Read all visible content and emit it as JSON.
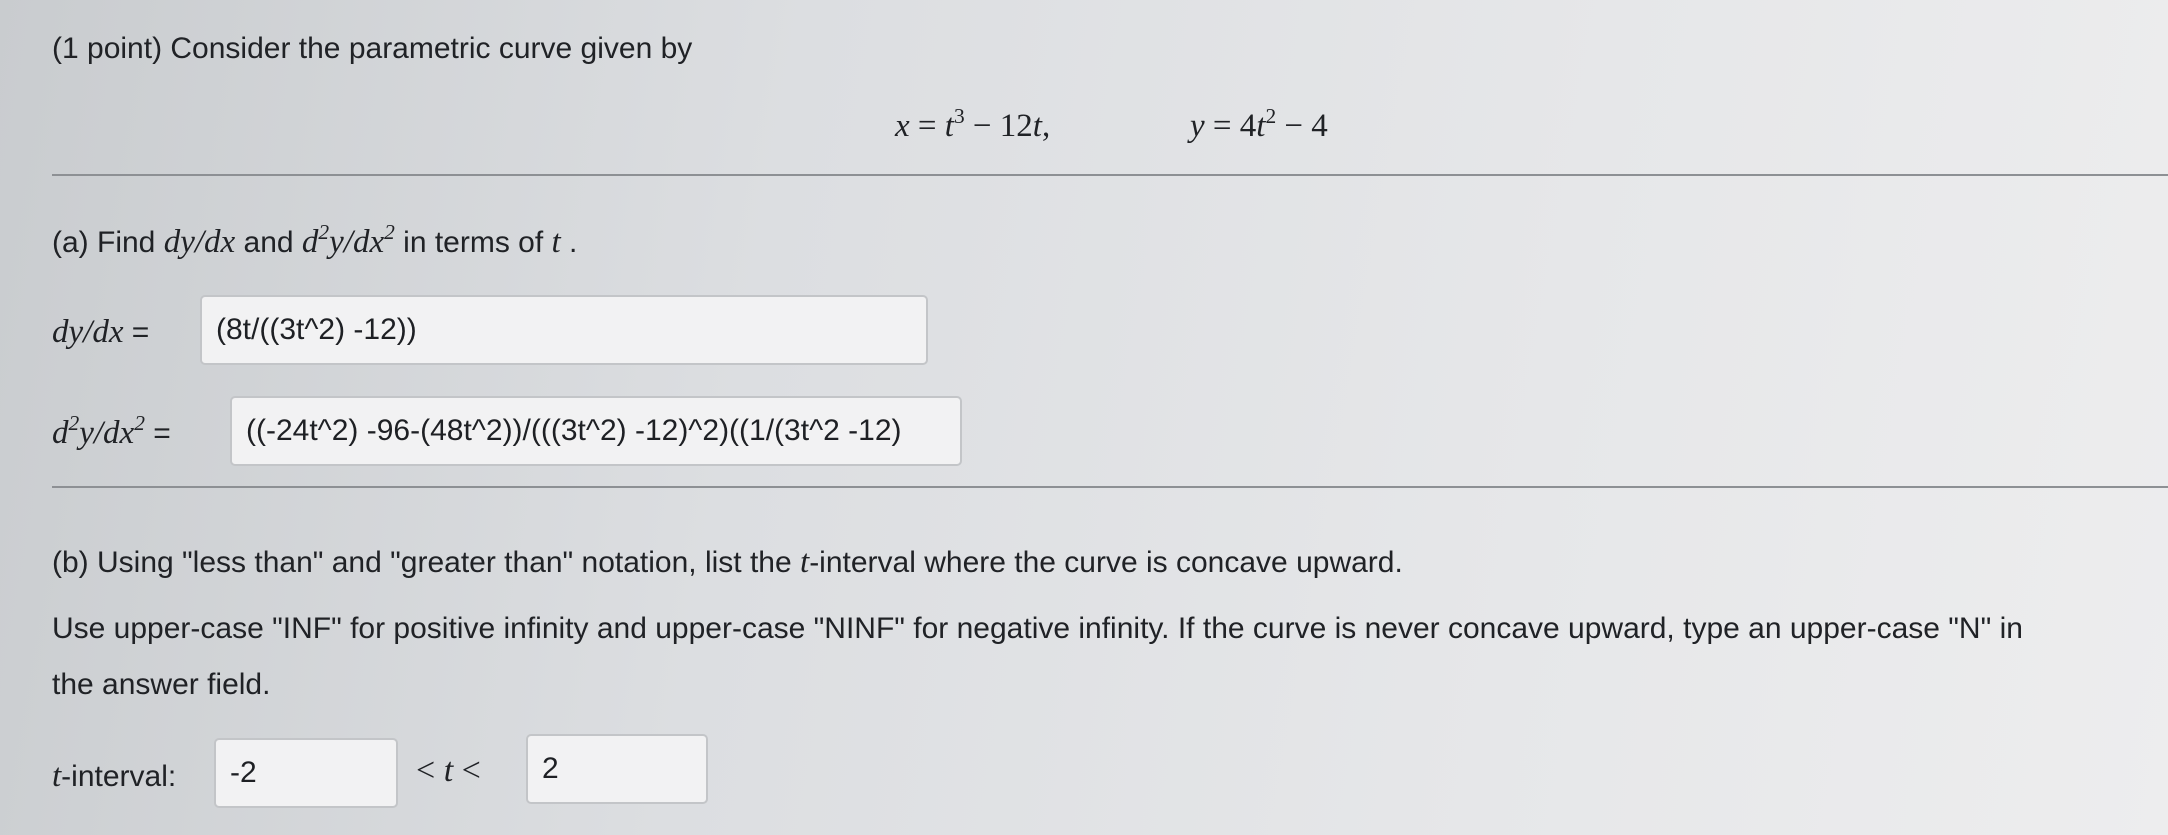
{
  "intro": {
    "text": "(1 point) Consider the parametric curve given by"
  },
  "equations": {
    "x_lhs": "x",
    "x_t": "t",
    "x_t_exp": "3",
    "x_rest": " − 12",
    "x_tail": ",",
    "y_lhs": "y",
    "y_coef": "4",
    "y_exp": "2",
    "y_rest": " − 4"
  },
  "part_a": {
    "prompt_start": "(a) Find ",
    "dydx": "dy/dx",
    "and": " and ",
    "d2_prefix": "d",
    "d2_mid": "y/dx",
    "sup2": "2",
    "in_terms": " in terms of ",
    "t": "t",
    "period": " .",
    "dydx_label": "dy/dx",
    "equals": " =",
    "dydx_value": "(8t/((3t^2) -12))",
    "d2_value": "((-24t^2) -96-(48t^2))/(((3t^2) -12)^2)((1/(3t^2 -12)"
  },
  "part_b": {
    "prompt_1": "(b) Using \"less than\" and \"greater than\" notation, list the ",
    "prompt_2": "-interval where the curve is concave upward.",
    "instructions_line1": "Use upper-case \"INF\" for positive infinity and upper-case \"NINF\" for negative infinity. If the curve is never concave upward, type an upper-case \"N\" in",
    "instructions_line2": "the answer field.",
    "interval_label": "-interval:",
    "lower_value": "-2",
    "lt": "<",
    "upper_value": "2"
  }
}
